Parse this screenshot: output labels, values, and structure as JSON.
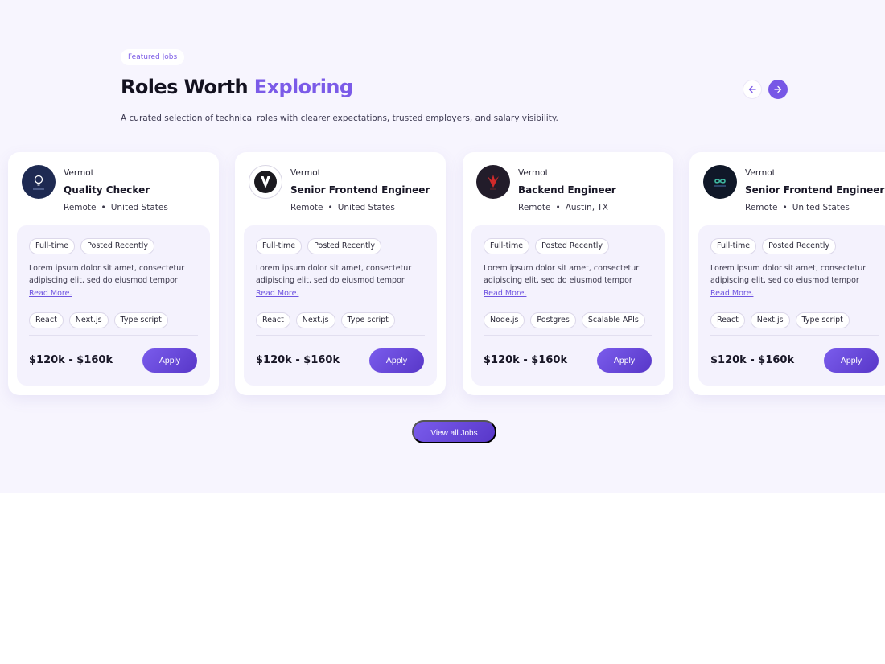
{
  "section": {
    "eyebrow": "Featured Jobs",
    "title_main": "Roles Worth",
    "title_accent": "Exploring",
    "subtitle": "A curated selection of technical roles with clearer expectations, trusted employers, and salary visibility.",
    "view_all_label": "View all Jobs",
    "colors": {
      "accent": "#7b5be8",
      "background": "#f7f5fe",
      "inner_card": "#f4f2fd"
    }
  },
  "carousel": {
    "prev_icon": "arrow-left-icon",
    "next_icon": "arrow-right-icon"
  },
  "jobs": [
    {
      "company": "Vermot",
      "role": "Quality Checker",
      "work_mode": "Remote",
      "location": "United States",
      "badges": [
        "Full-time",
        "Posted Recently"
      ],
      "description": "Lorem ipsum dolor sit amet, consectetur adipiscing elit, sed do eiusmod tempor",
      "read_more": "Read More.",
      "tags": [
        "React",
        "Next.js",
        "Type script"
      ],
      "salary": "$120k - $160k",
      "apply_label": "Apply",
      "logo_icon": "bulb-logo-icon"
    },
    {
      "company": "Vermot",
      "role": "Senior Frontend Engineer",
      "work_mode": "Remote",
      "location": "United States",
      "badges": [
        "Full-time",
        "Posted Recently"
      ],
      "description": "Lorem ipsum dolor sit amet, consectetur adipiscing elit, sed do eiusmod tempor",
      "read_more": "Read More.",
      "tags": [
        "React",
        "Next.js",
        "Type script"
      ],
      "salary": "$120k - $160k",
      "apply_label": "Apply",
      "logo_icon": "v-logo-icon"
    },
    {
      "company": "Vermot",
      "role": "Backend Engineer",
      "work_mode": "Remote",
      "location": "Austin, TX",
      "badges": [
        "Full-time",
        "Posted Recently"
      ],
      "description": "Lorem ipsum dolor sit amet, consectetur adipiscing elit, sed do eiusmod tempor",
      "read_more": "Read More.",
      "tags": [
        "Node.js",
        "Postgres",
        "Scalable APIs"
      ],
      "salary": "$120k - $160k",
      "apply_label": "Apply",
      "logo_icon": "bird-logo-icon"
    },
    {
      "company": "Vermot",
      "role": "Senior Frontend Engineer",
      "work_mode": "Remote",
      "location": "United States",
      "badges": [
        "Full-time",
        "Posted Recently"
      ],
      "description": "Lorem ipsum dolor sit amet, consectetur adipiscing elit, sed do eiusmod tempor",
      "read_more": "Read More.",
      "tags": [
        "React",
        "Next.js",
        "Type script"
      ],
      "salary": "$120k - $160k",
      "apply_label": "Apply",
      "logo_icon": "infinity-logo-icon"
    }
  ]
}
